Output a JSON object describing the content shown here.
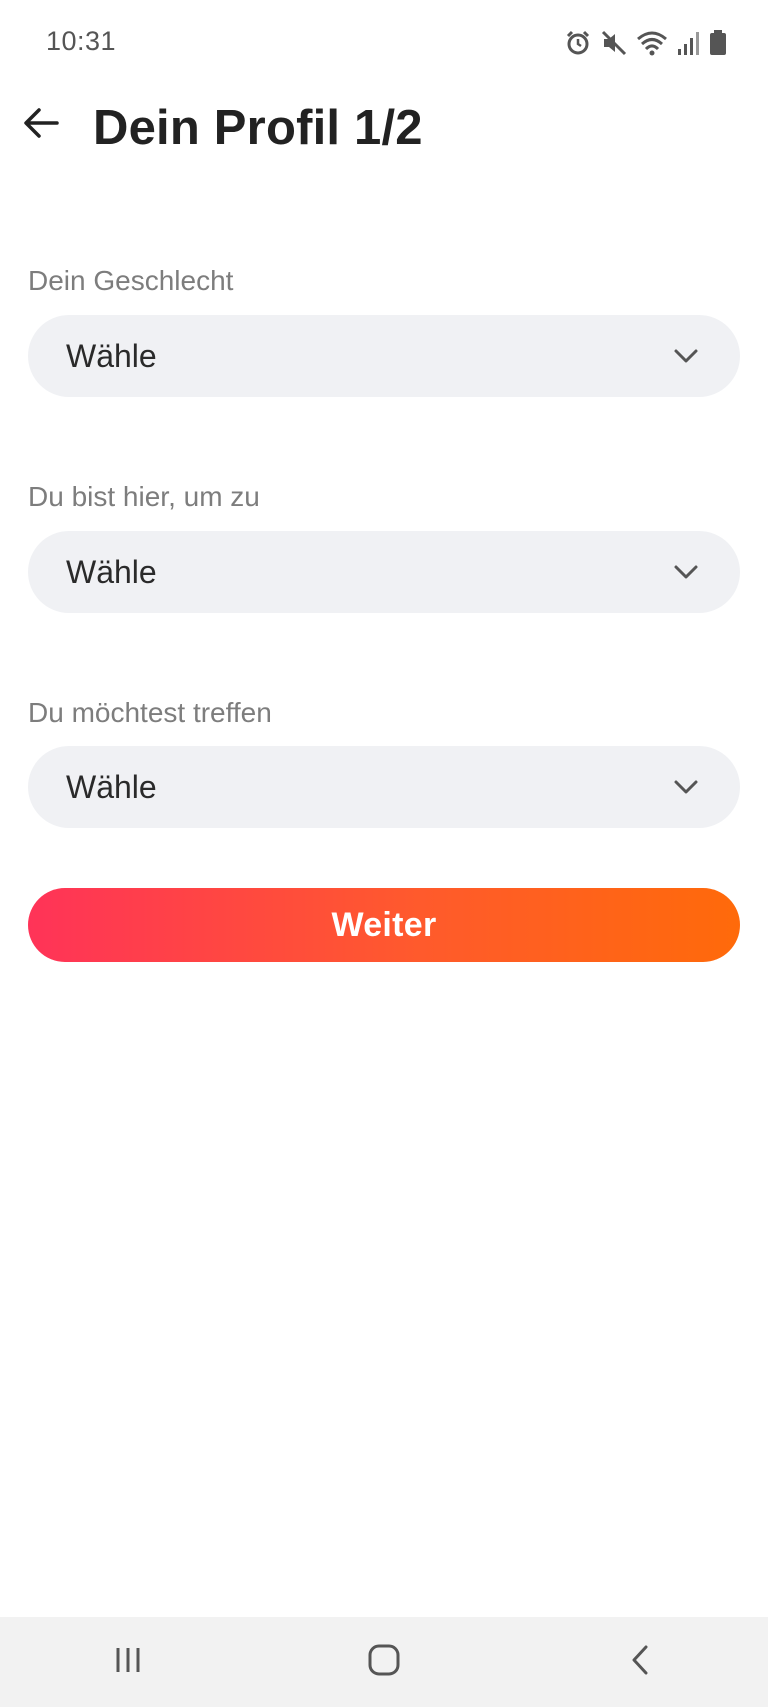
{
  "status_bar": {
    "time": "10:31",
    "icons": [
      "alarm-icon",
      "mute-icon",
      "wifi-icon",
      "signal-icon",
      "battery-icon"
    ]
  },
  "header": {
    "title": "Dein Profil 1/2",
    "back_icon": "arrow-left-icon"
  },
  "form": {
    "fields": [
      {
        "label": "Dein Geschlecht",
        "value": "Wähle"
      },
      {
        "label": "Du bist hier, um zu",
        "value": "Wähle"
      },
      {
        "label": "Du möchtest treffen",
        "value": "Wähle"
      }
    ],
    "submit_label": "Weiter"
  },
  "nav_bar": {
    "items": [
      "recent-apps-icon",
      "home-icon",
      "back-icon"
    ]
  },
  "colors": {
    "accent_start": "#ff3358",
    "accent_end": "#ff6a0a",
    "field_bg": "#f0f1f4",
    "label": "#7d7d7d"
  }
}
